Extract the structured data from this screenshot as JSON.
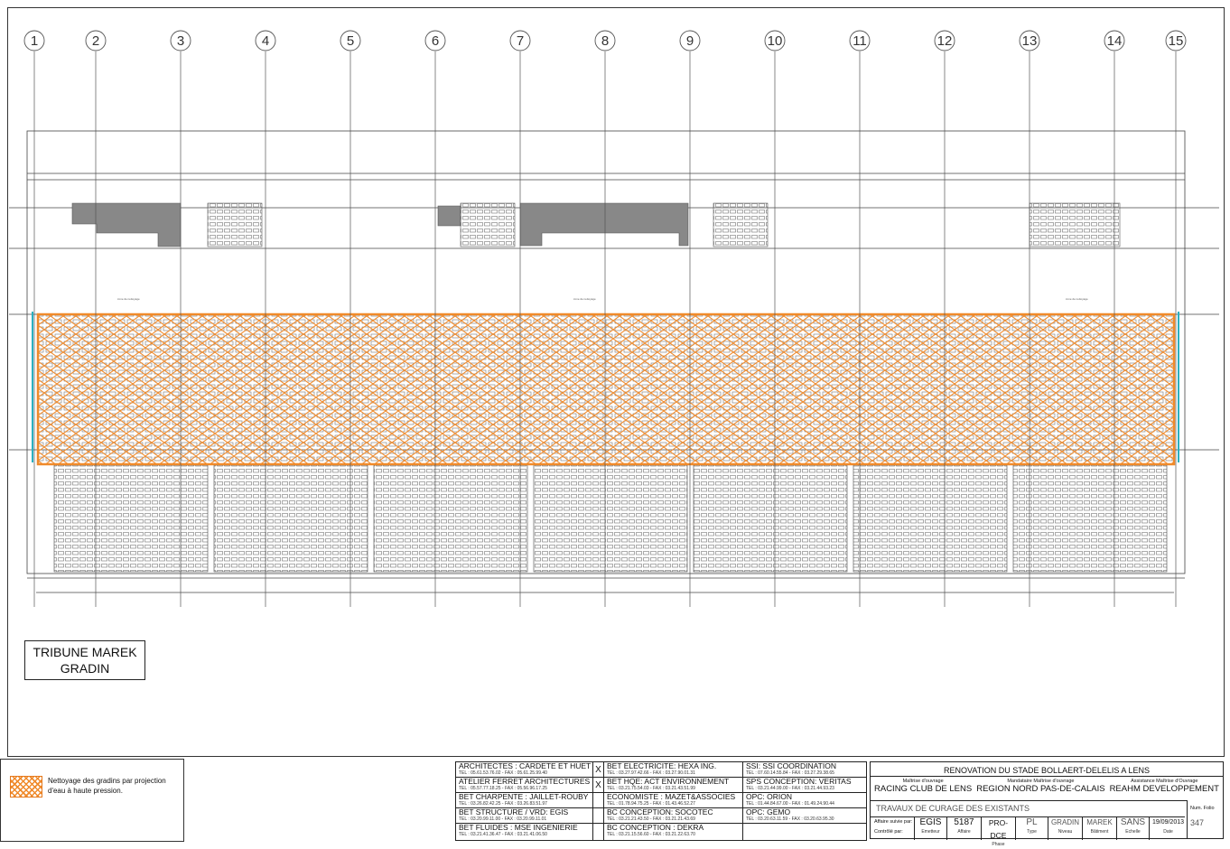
{
  "drawing": {
    "grid_axes": [
      "1",
      "2",
      "3",
      "4",
      "5",
      "6",
      "7",
      "8",
      "9",
      "10",
      "11",
      "12",
      "13",
      "14",
      "15"
    ],
    "title_line1": "TRIBUNE MAREK",
    "title_line2": "GRADIN",
    "hatch_color": "#f08a2a",
    "line_color": "#333333"
  },
  "legend": {
    "text": "Nettoyage des gradins par projection d'eau à haute pression."
  },
  "contacts": {
    "col1": [
      {
        "name": "ARCHITECTES : CARDETE ET HUET",
        "tel": "TEL : 05.61.53.76.02 - FAX : 05.61.25.99.40"
      },
      {
        "name": "ATELIER FERRET ARCHITECTURES",
        "tel": "TEL : 05.57.77.18.25 - FAX : 05.56.96.17.25"
      },
      {
        "name": "BET CHARPENTE : JAILLET-ROUBY",
        "tel": "TEL : 03.26.82.42.25 - FAX : 03.26.83.51.97"
      },
      {
        "name": "BET STRUCTURE / VRD: EGIS",
        "tel": "TEL : 03.20.99.11.00 - FAX : 03.20.99.11.01"
      },
      {
        "name": "BET FLUIDES : MSE INGENIERIE",
        "tel": "TEL : 03.21.41.36.47 - FAX : 03.21.41.06.50"
      }
    ],
    "xmarks": [
      "X",
      "X",
      "",
      "",
      ""
    ],
    "col2": [
      {
        "name": "BET ELECTRICITE: HEXA ING.",
        "tel": "TEL : 03.27.97.42.66 - FAX : 03.27.90.01.31"
      },
      {
        "name": "BET HQE: ACT ENVIRONNEMENT",
        "tel": "TEL : 03.21.75.54.03 - FAX : 03.21.43.51.99"
      },
      {
        "name": "ECONOMISTE : MAZET&ASSOCIES",
        "tel": "TEL : 01.78.94.75.25 - FAX : 01.43.46.52.27"
      },
      {
        "name": "BC CONCEPTION: SOCOTEC",
        "tel": "TEL : 03.21.21.43.50 - FAX : 03.21.21.43.69"
      },
      {
        "name": "BC CONCEPTION : DEKRA",
        "tel": "TEL : 03.21.15.56.60 - FAX : 03.21.22.63.70"
      }
    ],
    "col3": [
      {
        "name": "SSI: SSI COORDINATION",
        "tel": "TEL : 07.60.14.55.84 - FAX : 03.27.29.38.65"
      },
      {
        "name": "SPS CONCEPTION: VERITAS",
        "tel": "TEL : 03.21.44.99.00 - FAX : 03.21.44.93.23"
      },
      {
        "name": "OPC: ORION",
        "tel": "TEL : 01.44.84.67.00 - FAX : 01.49.24.90.44"
      },
      {
        "name": "OPC: GEMO",
        "tel": "TEL : 03.20.63.11.59 - FAX : 03.20.63.95.30"
      },
      {
        "name": "",
        "tel": ""
      }
    ]
  },
  "title_block": {
    "project": "RENOVATION DU STADE BOLLAERT-DELELIS A LENS",
    "roles": [
      {
        "label": "Maîtrise d'ouvrage",
        "value": "RACING CLUB DE LENS"
      },
      {
        "label": "Mandataire Maîtrise d'ouvrage",
        "value": "REGION NORD PAS-DE-CALAIS"
      },
      {
        "label": "Assistance Maîtrise d'Ouvrage",
        "value": "REAHM DEVELOPPEMENT"
      }
    ],
    "works": "TRAVAUX DE CURAGE DES EXISTANTS",
    "folio_label": "Num. Folio",
    "folio": "347",
    "suivi_label": "Affaire suivie par:",
    "controle_label": "Contrôlé par:",
    "codes": [
      {
        "value": "EGIS",
        "label": "Emetteur"
      },
      {
        "value": "5187",
        "label": "Affaire"
      },
      {
        "value": "PRO-DCE",
        "label": "Phase"
      },
      {
        "value": "PL",
        "label": "Type"
      },
      {
        "value": "GRADIN",
        "label": "Niveau"
      },
      {
        "value": "MAREK",
        "label": "Bâtiment"
      },
      {
        "value": "SANS",
        "label": "Echelle"
      },
      {
        "value": "19/09/2013",
        "label": "Date"
      }
    ]
  }
}
